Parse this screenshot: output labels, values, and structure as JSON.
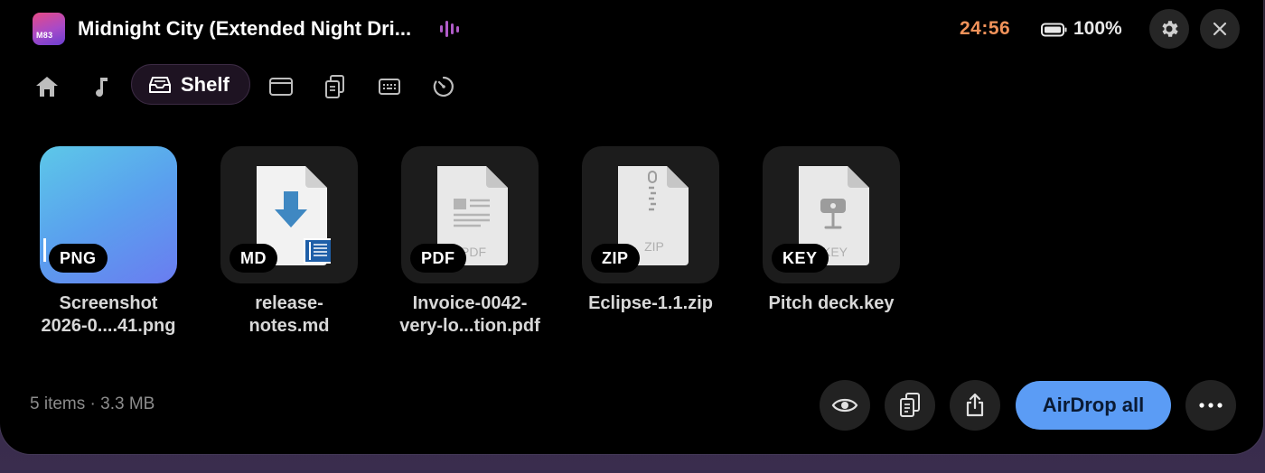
{
  "player": {
    "album_art_label": "M83",
    "track_title": "Midnight City (Extended Night Dri...",
    "time": "24:56",
    "battery": "100%"
  },
  "tabs": {
    "items": [
      "home-icon",
      "music-icon",
      "shelf",
      "window-icon",
      "clipboard-icon",
      "keyboard-icon",
      "timer-icon"
    ],
    "active_label": "Shelf"
  },
  "files": [
    {
      "name_line1": "Screenshot",
      "name_line2": "2026-0....41.png",
      "badge": "PNG"
    },
    {
      "name_line1": "release-",
      "name_line2": "notes.md",
      "badge": "MD"
    },
    {
      "name_line1": "Invoice-0042-",
      "name_line2": "very-lo...tion.pdf",
      "badge": "PDF",
      "doc_label": "PDF"
    },
    {
      "name_line1": "Eclipse-1.1.zip",
      "name_line2": "",
      "badge": "ZIP",
      "doc_label": "ZIP"
    },
    {
      "name_line1": "Pitch deck.key",
      "name_line2": "",
      "badge": "KEY",
      "doc_label": "KEY"
    }
  ],
  "footer": {
    "summary": "5 items · 3.3 MB",
    "airdrop_label": "AirDrop all"
  },
  "colors": {
    "accent": "#5b9cf5",
    "clock": "#f0925a",
    "eq": "#b05cc8"
  }
}
